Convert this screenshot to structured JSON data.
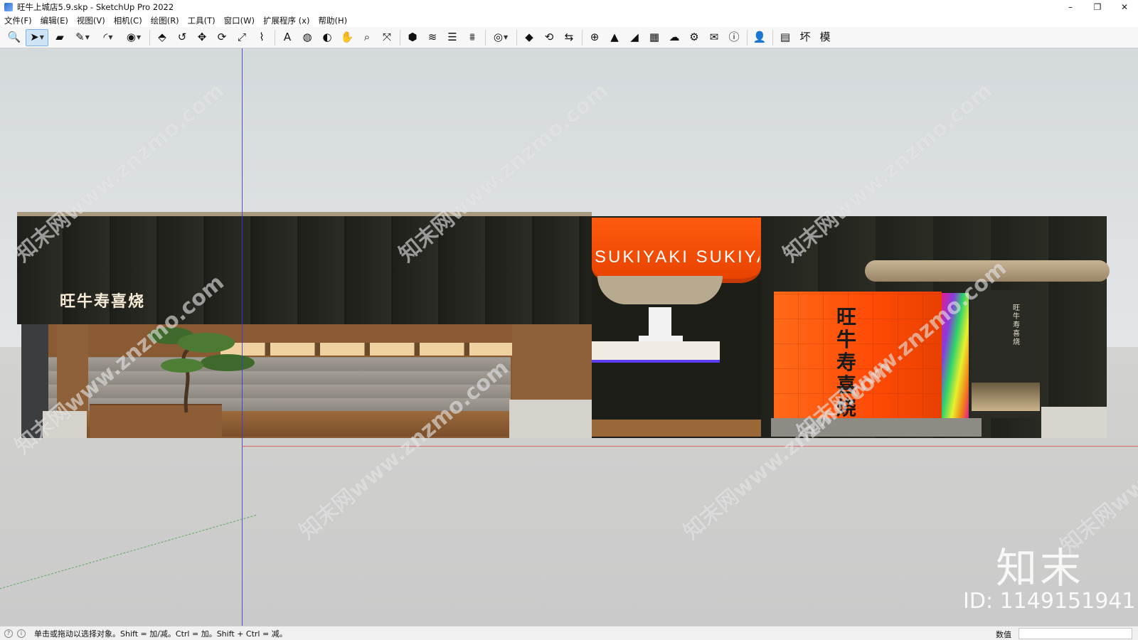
{
  "window": {
    "title": "旺牛上城店5.9.skp - SketchUp Pro 2022",
    "minimize": "–",
    "restore": "❐",
    "close": "✕"
  },
  "menu": [
    "文件(F)",
    "编辑(E)",
    "视图(V)",
    "相机(C)",
    "绘图(R)",
    "工具(T)",
    "窗口(W)",
    "扩展程序 (x)",
    "帮助(H)"
  ],
  "toolbar": {
    "tools": [
      {
        "name": "zoom-icon",
        "glyph": "🔍"
      },
      {
        "name": "select-icon",
        "glyph": "➤",
        "active": true,
        "dropdown": true
      },
      {
        "name": "eraser-icon",
        "glyph": "▰"
      },
      {
        "name": "pencil-icon",
        "glyph": "✎",
        "dropdown": true
      },
      {
        "name": "arc-icon",
        "glyph": "◜",
        "dropdown": true
      },
      {
        "name": "circle-icon",
        "glyph": "◉",
        "dropdown": true
      },
      {
        "name": "push-pull-icon",
        "glyph": "⬘"
      },
      {
        "name": "offset-icon",
        "glyph": "↺"
      },
      {
        "name": "move-icon",
        "glyph": "✥"
      },
      {
        "name": "rotate-icon",
        "glyph": "⟳"
      },
      {
        "name": "scale-icon",
        "glyph": "⤢"
      },
      {
        "name": "tape-measure-icon",
        "glyph": "⌇"
      },
      {
        "name": "text-icon",
        "glyph": "A"
      },
      {
        "name": "paint-bucket-icon",
        "glyph": "◍"
      },
      {
        "name": "orbit-icon",
        "glyph": "◐"
      },
      {
        "name": "pan-icon",
        "glyph": "✋"
      },
      {
        "name": "zoom-window-icon",
        "glyph": "⌕"
      },
      {
        "name": "zoom-extents-icon",
        "glyph": "⤧"
      },
      {
        "name": "warehouse-icon",
        "glyph": "⬢"
      },
      {
        "name": "sandbox-icon",
        "glyph": "≋"
      },
      {
        "name": "layers-icon",
        "glyph": "☰"
      },
      {
        "name": "styles-icon",
        "glyph": "⩩"
      },
      {
        "name": "account-icon",
        "glyph": "◎",
        "dropdown": true
      },
      {
        "name": "extension-warehouse-icon",
        "glyph": "◆"
      },
      {
        "name": "sync-icon",
        "glyph": "⟲"
      },
      {
        "name": "export-icon",
        "glyph": "⇆"
      },
      {
        "name": "add-icon",
        "glyph": "⊕"
      },
      {
        "name": "tree-icon",
        "glyph": "▲"
      },
      {
        "name": "section-icon",
        "glyph": "◢"
      },
      {
        "name": "checker-icon",
        "glyph": "▦"
      },
      {
        "name": "cloud-icon",
        "glyph": "☁"
      },
      {
        "name": "settings-icon",
        "glyph": "⚙"
      },
      {
        "name": "mail-icon",
        "glyph": "✉"
      },
      {
        "name": "info-icon",
        "glyph": "ⓘ"
      },
      {
        "name": "user-icon",
        "glyph": "👤"
      },
      {
        "name": "table-icon",
        "glyph": "▤"
      },
      {
        "name": "plugin-huan-icon",
        "glyph": "坏"
      },
      {
        "name": "plugin-mo-icon",
        "glyph": "模"
      }
    ]
  },
  "scene": {
    "sign_left": "旺牛寿喜烧",
    "drum_text": "SUKIYAKI SUKIYAKI",
    "panel_text": "旺牛寿喜烧",
    "side_text": "旺牛寿喜烧"
  },
  "watermarks": {
    "text": "知末网www.znzmo.com",
    "brand": "知末",
    "id": "ID: 1149151941"
  },
  "status": {
    "hint": "单击或拖动以选择对象。Shift = 加/减。Ctrl = 加。Shift + Ctrl = 减。",
    "measurements_label": "数值",
    "measurements_value": ""
  },
  "colors": {
    "accent_orange": "#ff5a10",
    "facade_dark": "#1e1f1a",
    "wood": "#8f6138",
    "axis_blue": "#3a3ad8",
    "axis_red": "#e03a3a"
  }
}
